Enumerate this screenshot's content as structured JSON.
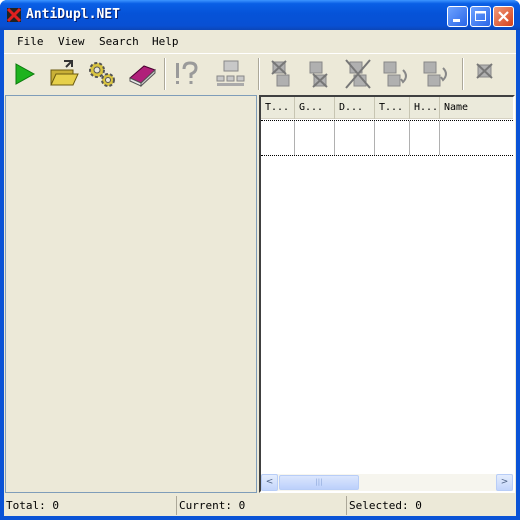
{
  "window": {
    "title": "AntiDupl.NET"
  },
  "menu": [
    "File",
    "View",
    "Search",
    "Help"
  ],
  "toolbar": {
    "icons": [
      "start-search-icon",
      "open-icon",
      "options-icon",
      "clear-icon",
      "help-icon",
      "database-icon",
      "delete-first-icon",
      "delete-second-icon",
      "delete-both-icon",
      "rename-first-icon",
      "rename-second-icon",
      "mistake-icon"
    ]
  },
  "results": {
    "columns": [
      "T...",
      "G...",
      "D...",
      "T...",
      "H...",
      "Name"
    ]
  },
  "status": {
    "total": "Total: 0",
    "current": "Current: 0",
    "selected": "Selected: 0"
  },
  "scrollbar": {
    "left_arrow": "<",
    "right_arrow": ">",
    "thumb_grip": "|||"
  },
  "colors": {
    "titlebar": "#0553d8",
    "client": "#ece9d8",
    "play": "#1eb31e",
    "close": "#d6401a"
  }
}
